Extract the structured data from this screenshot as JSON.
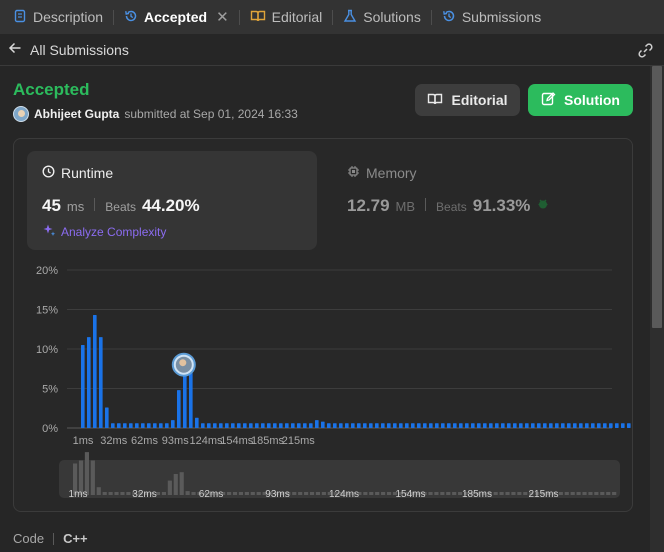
{
  "tabs": [
    {
      "label": "Description",
      "active": false
    },
    {
      "label": "Accepted",
      "active": true
    },
    {
      "label": "Editorial",
      "active": false
    },
    {
      "label": "Solutions",
      "active": false
    },
    {
      "label": "Submissions",
      "active": false
    }
  ],
  "subheader": {
    "back_label": "All Submissions"
  },
  "submission": {
    "status": "Accepted",
    "user": "Abhijeet Gupta",
    "submitted_text": "submitted at Sep 01, 2024 16:33"
  },
  "buttons": {
    "editorial": "Editorial",
    "solution": "Solution"
  },
  "runtime": {
    "title": "Runtime",
    "value": "45",
    "unit": "ms",
    "beats_label": "Beats",
    "beats": "44.20%",
    "analyze": "Analyze Complexity"
  },
  "memory": {
    "title": "Memory",
    "value": "12.79",
    "unit": "MB",
    "beats_label": "Beats",
    "beats": "91.33%"
  },
  "code": {
    "label": "Code",
    "language": "C++"
  },
  "colors": {
    "accent_green": "#2cbb5d",
    "bar_blue": "#1a73e8",
    "purple": "#8b6cf0",
    "overview_bar": "#5a5a5a"
  },
  "chart_data": {
    "type": "bar",
    "title": "",
    "xlabel": "",
    "ylabel": "",
    "y_ticks": [
      "20%",
      "15%",
      "10%",
      "5%",
      "0%"
    ],
    "ylim": [
      0,
      20
    ],
    "x_tick_labels": [
      "1ms",
      "32ms",
      "62ms",
      "93ms",
      "124ms",
      "154ms",
      "185ms",
      "215ms"
    ],
    "grid": true,
    "highlighted_bin_index": 17,
    "values": [
      10.5,
      11.5,
      14.3,
      11.5,
      2.6,
      0.6,
      0.6,
      0.6,
      0.6,
      0.6,
      0.6,
      0.6,
      0.6,
      0.6,
      0.6,
      1.0,
      4.8,
      7.0,
      7.6,
      1.3,
      0.6,
      0.6,
      0.6,
      0.6,
      0.6,
      0.6,
      0.6,
      0.6,
      0.6,
      0.6,
      0.6,
      0.6,
      0.6,
      0.6,
      0.6,
      0.6,
      0.6,
      0.6,
      0.6,
      1.0,
      0.8,
      0.6,
      0.6,
      0.6,
      0.6,
      0.6,
      0.6,
      0.6,
      0.6,
      0.6,
      0.6,
      0.6,
      0.6,
      0.6,
      0.6,
      0.6,
      0.6,
      0.6,
      0.6,
      0.6,
      0.6,
      0.6,
      0.6,
      0.6,
      0.6,
      0.6,
      0.6,
      0.6,
      0.6,
      0.6,
      0.6,
      0.6,
      0.6,
      0.6,
      0.6,
      0.6,
      0.6,
      0.6,
      0.6,
      0.6,
      0.6,
      0.6,
      0.6,
      0.6,
      0.6,
      0.6,
      0.6,
      0.6,
      0.6,
      0.6,
      0.6,
      0.6
    ]
  }
}
